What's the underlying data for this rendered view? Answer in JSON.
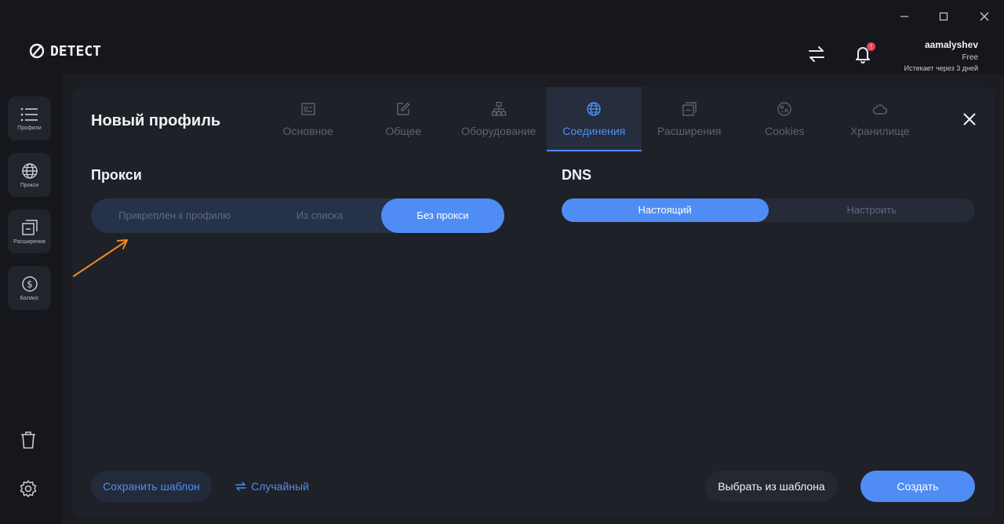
{
  "app": {
    "logo_text": "DETECT"
  },
  "user": {
    "name": "aamalyshev",
    "plan": "Free",
    "expires": "Истекает через 3 дней",
    "notifications": "!"
  },
  "sidebar": {
    "items": [
      {
        "label": "Профили",
        "icon": "list-icon"
      },
      {
        "label": "Прокси",
        "icon": "globe-icon"
      },
      {
        "label": "Расширения",
        "icon": "extensions-icon"
      },
      {
        "label": "Баланс",
        "icon": "dollar-icon"
      }
    ]
  },
  "panel": {
    "title": "Новый профиль",
    "tabs": [
      {
        "label": "Основное",
        "icon": "id-card-icon",
        "active": false
      },
      {
        "label": "Общее",
        "icon": "edit-icon",
        "active": false
      },
      {
        "label": "Оборудование",
        "icon": "hierarchy-icon",
        "active": false
      },
      {
        "label": "Соединения",
        "icon": "globe-icon",
        "active": true
      },
      {
        "label": "Расширения",
        "icon": "extensions-icon",
        "active": false
      },
      {
        "label": "Cookies",
        "icon": "cookie-icon",
        "active": false
      },
      {
        "label": "Хранилище",
        "icon": "cloud-icon",
        "active": false
      }
    ]
  },
  "proxy": {
    "title": "Прокси",
    "options": [
      "Прикреплен к профилю",
      "Из списка",
      "Без прокси"
    ],
    "selected": "Без прокси"
  },
  "dns": {
    "title": "DNS",
    "options": [
      "Настоящий",
      "Настроить"
    ],
    "selected": "Настоящий"
  },
  "footer": {
    "save_template": "Сохранить шаблон",
    "random": "Случайный",
    "choose_template": "Выбрать из шаблона",
    "create": "Создать"
  },
  "colors": {
    "accent": "#4f8df5",
    "annotation_arrow": "#f08a24"
  }
}
